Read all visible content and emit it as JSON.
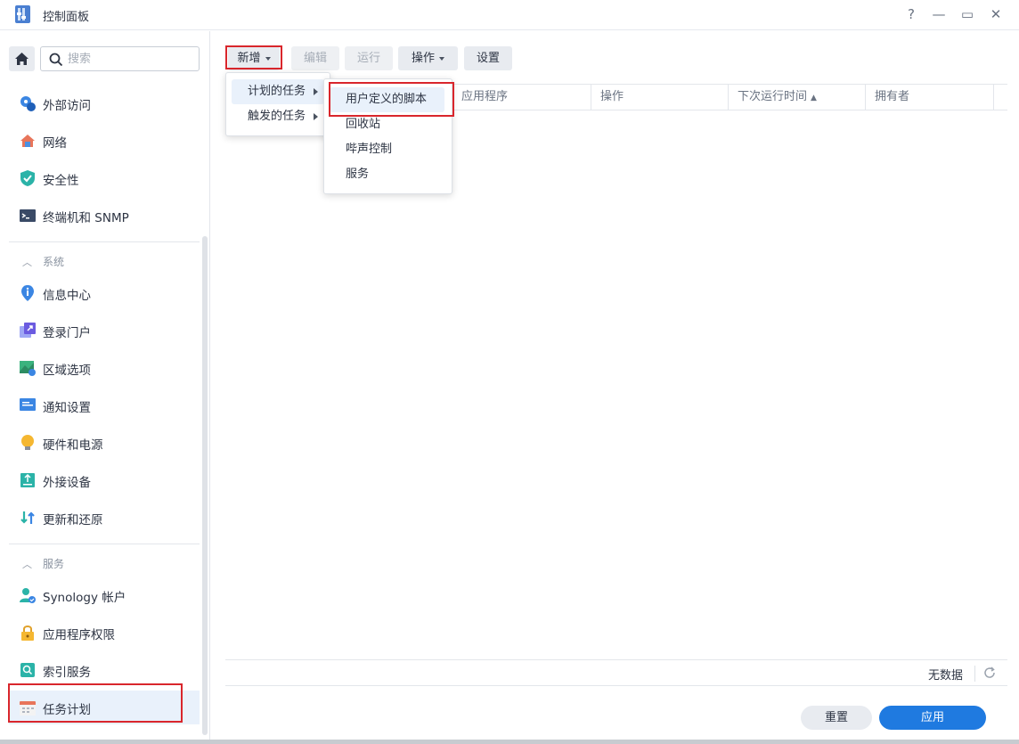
{
  "window": {
    "title": "控制面板",
    "help": "?",
    "minimize": "—",
    "maximize": "▭",
    "close": "✕"
  },
  "sidebar": {
    "search_placeholder": "搜索",
    "items_top": [
      {
        "label": "外部访问",
        "icon": "external-access-icon"
      },
      {
        "label": "网络",
        "icon": "network-icon"
      },
      {
        "label": "安全性",
        "icon": "security-shield-icon"
      },
      {
        "label": "终端机和 SNMP",
        "icon": "terminal-icon"
      }
    ],
    "group_system": "系统",
    "items_system": [
      {
        "label": "信息中心",
        "icon": "info-center-icon"
      },
      {
        "label": "登录门户",
        "icon": "login-portal-icon"
      },
      {
        "label": "区域选项",
        "icon": "regional-options-icon"
      },
      {
        "label": "通知设置",
        "icon": "notification-icon"
      },
      {
        "label": "硬件和电源",
        "icon": "hardware-power-icon"
      },
      {
        "label": "外接设备",
        "icon": "external-devices-icon"
      },
      {
        "label": "更新和还原",
        "icon": "update-restore-icon"
      }
    ],
    "group_services": "服务",
    "items_services": [
      {
        "label": "Synology 帐户",
        "icon": "synology-account-icon"
      },
      {
        "label": "应用程序权限",
        "icon": "app-privileges-icon"
      },
      {
        "label": "索引服务",
        "icon": "indexing-service-icon"
      },
      {
        "label": "任务计划",
        "icon": "task-scheduler-icon"
      }
    ]
  },
  "toolbar": {
    "create": "新增",
    "edit": "编辑",
    "run": "运行",
    "action": "操作",
    "settings": "设置"
  },
  "grid": {
    "columns": [
      "应用程序",
      "操作",
      "下次运行时间",
      "拥有者"
    ],
    "sort_indicator": "▲",
    "empty_text": "无数据"
  },
  "menu_create": {
    "items": [
      "计划的任务",
      "触发的任务"
    ]
  },
  "submenu_scheduled": {
    "items": [
      "用户定义的脚本",
      "回收站",
      "哔声控制",
      "服务"
    ]
  },
  "footer": {
    "reset": "重置",
    "apply": "应用"
  },
  "colors": {
    "accent": "#1f7ae0",
    "highlight_box": "#d9262c"
  }
}
